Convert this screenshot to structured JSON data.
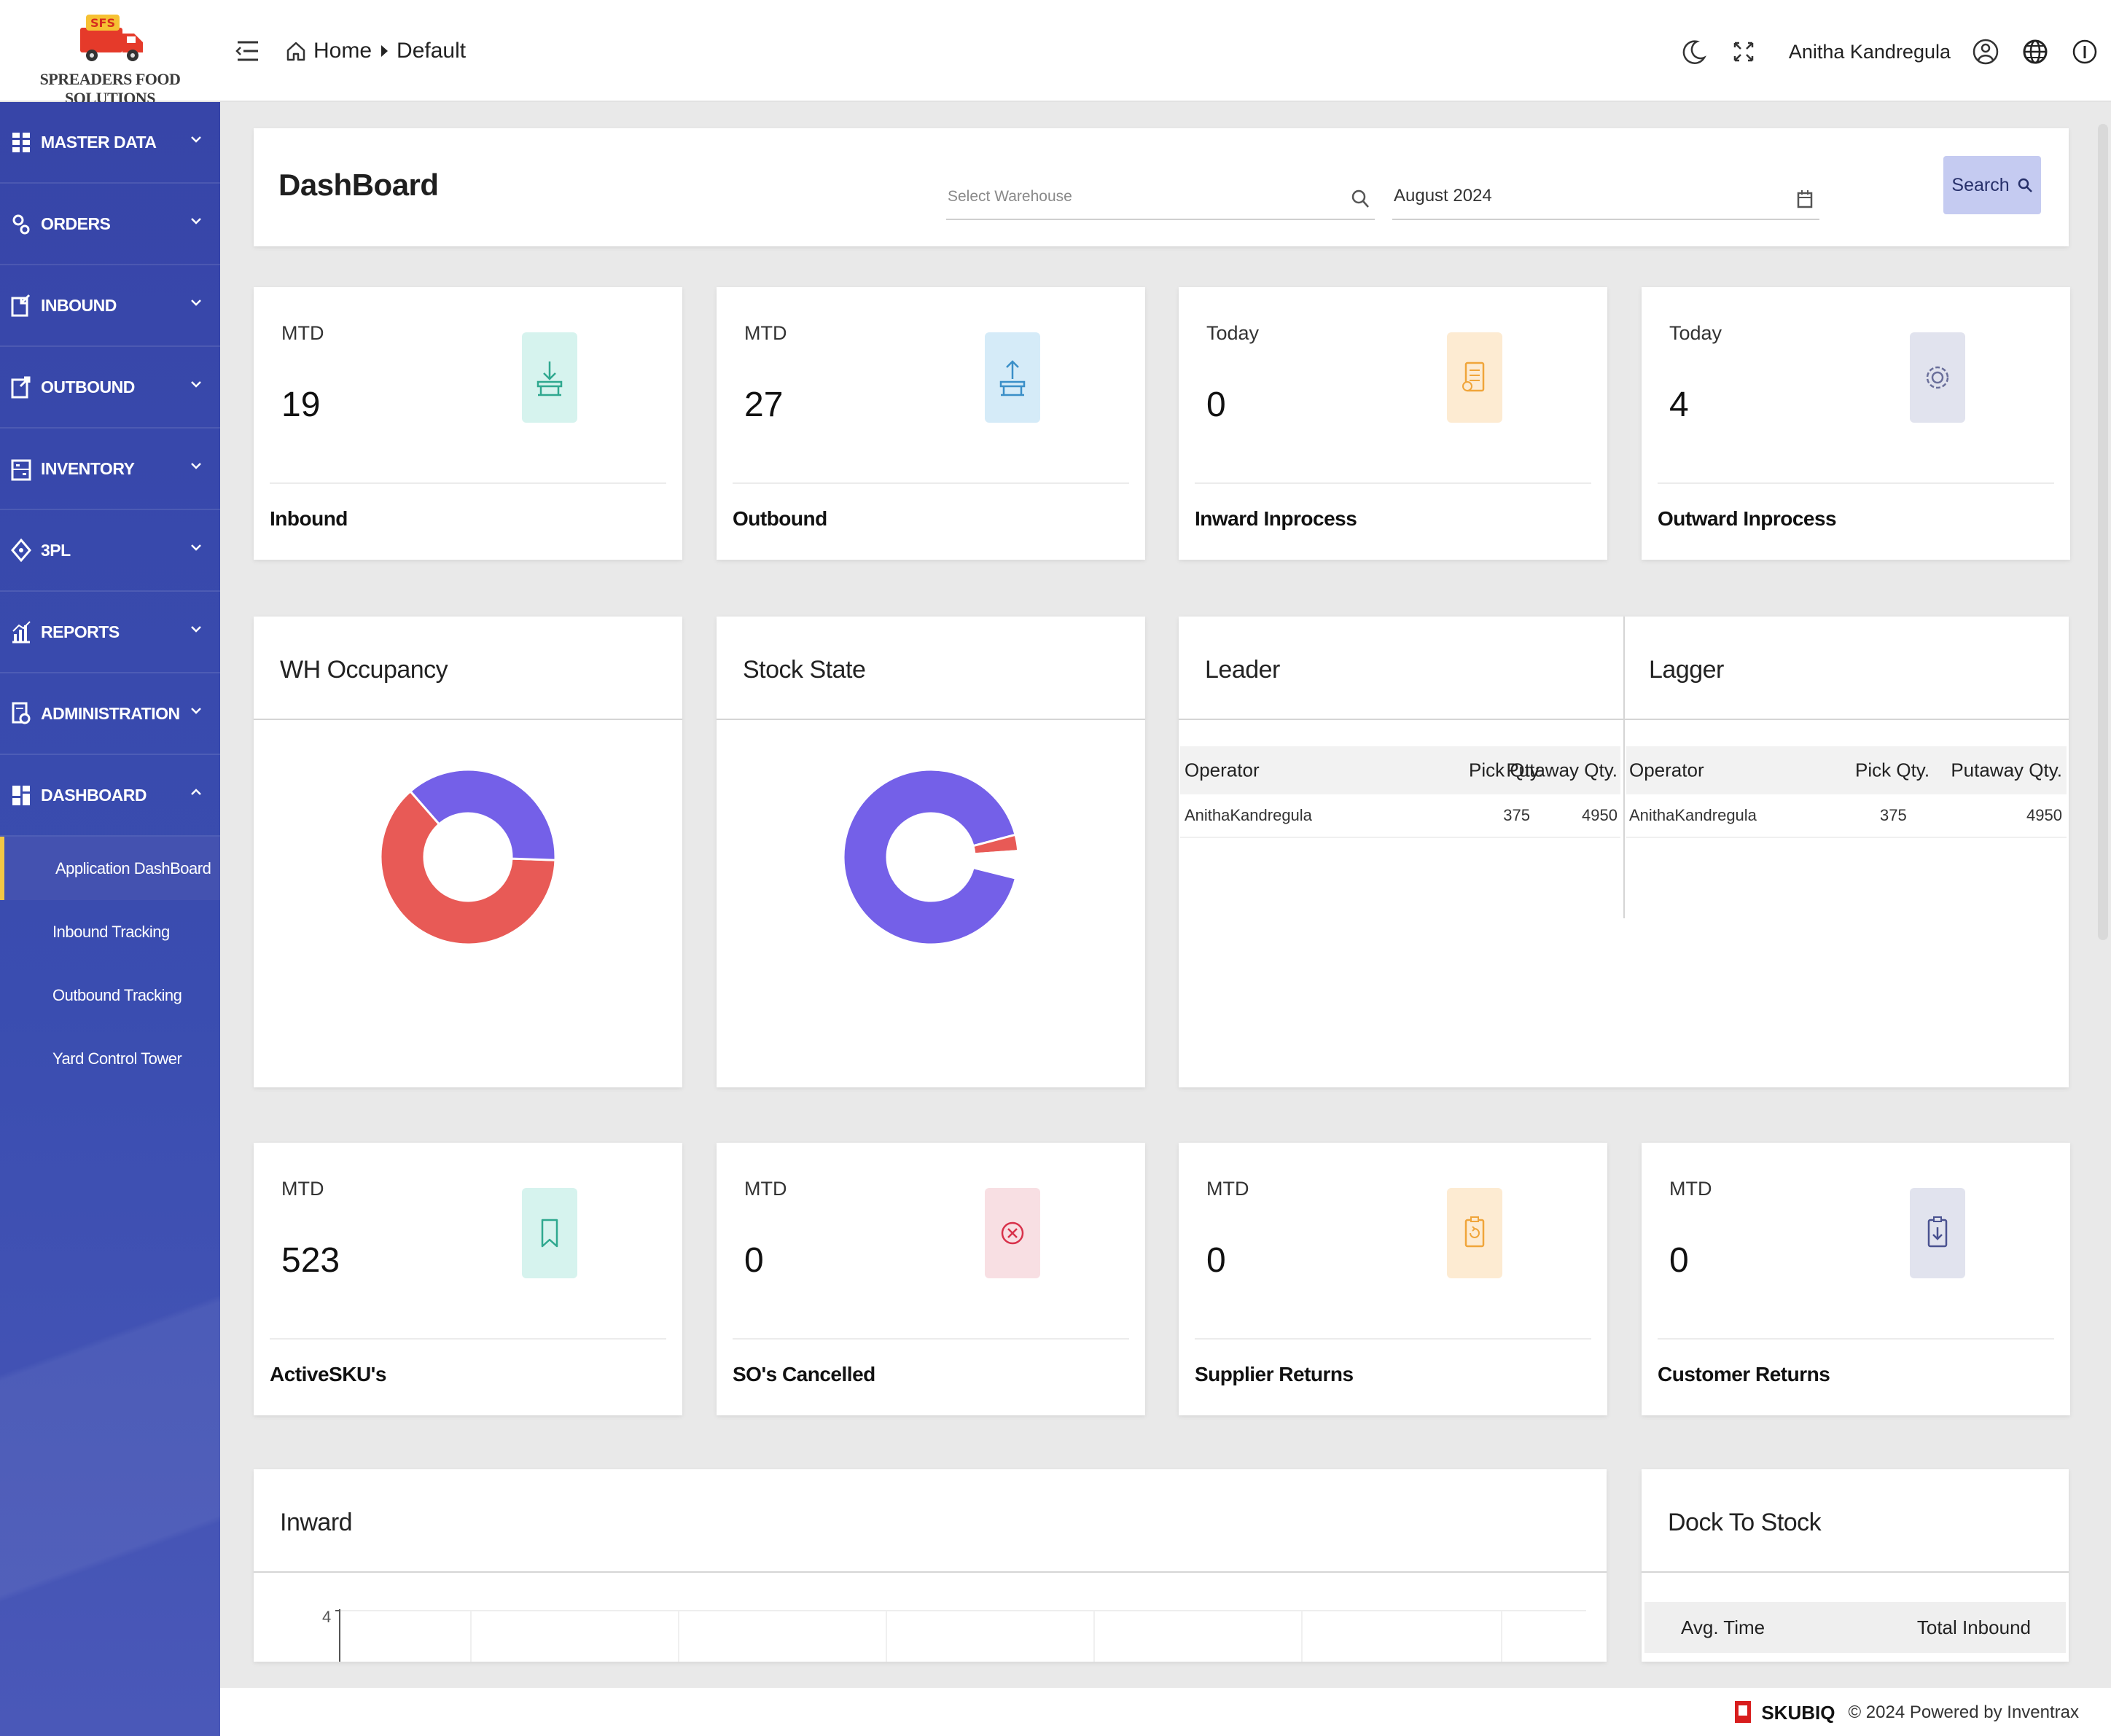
{
  "brand": {
    "logo_badge": "SFS",
    "name": "SPREADERS FOOD SOLUTIONS"
  },
  "topbar": {
    "breadcrumb": [
      "Home",
      "Default"
    ],
    "user_name": "Anitha  Kandregula",
    "icons": [
      "moon-icon",
      "fullscreen-icon",
      "user-circle-icon",
      "globe-icon",
      "info-icon"
    ]
  },
  "sidebar": {
    "items": [
      {
        "label": "MASTER DATA",
        "icon": "grid-icon"
      },
      {
        "label": "ORDERS",
        "icon": "gears-icon"
      },
      {
        "label": "INBOUND",
        "icon": "inbound-icon"
      },
      {
        "label": "OUTBOUND",
        "icon": "outbound-icon"
      },
      {
        "label": "INVENTORY",
        "icon": "inventory-icon"
      },
      {
        "label": "3PL",
        "icon": "diamond-icon"
      },
      {
        "label": "REPORTS",
        "icon": "bar-chart-icon"
      },
      {
        "label": "ADMINISTRATION",
        "icon": "admin-icon"
      },
      {
        "label": "DASHBOARD",
        "icon": "dashboard-icon",
        "expanded": true
      }
    ],
    "sub_items": [
      "Application DashBoard",
      "Inbound Tracking",
      "Outbound Tracking",
      "Yard Control Tower"
    ],
    "active_sub_item": "Application DashBoard"
  },
  "header": {
    "title": "DashBoard",
    "warehouse_placeholder": "Select Warehouse",
    "date_value": "August 2024",
    "search_label": "Search"
  },
  "stats_top": [
    {
      "period": "MTD",
      "value": "19",
      "label": "Inbound",
      "badge_color": "#d6f3ee",
      "icon": "truck-unload-icon"
    },
    {
      "period": "MTD",
      "value": "27",
      "label": "Outbound",
      "badge_color": "#d5ebf8",
      "icon": "truck-load-icon"
    },
    {
      "period": "Today",
      "value": "0",
      "label": "Inward Inprocess",
      "badge_color": "#fdebd2",
      "icon": "document-icon"
    },
    {
      "period": "Today",
      "value": "4",
      "label": "Outward Inprocess",
      "badge_color": "#e1e3ee",
      "icon": "gear-cycle-icon"
    }
  ],
  "charts": {
    "wh_occupancy": {
      "title": "WH Occupancy"
    },
    "stock_state": {
      "title": "Stock State"
    },
    "leader": {
      "title": "Leader",
      "columns": [
        "Operator",
        "Pick Qty.",
        "Putaway Qty."
      ],
      "rows": [
        [
          "AnithaKandregula",
          "375",
          "4950"
        ]
      ]
    },
    "lagger": {
      "title": "Lagger",
      "columns": [
        "Operator",
        "Pick Qty.",
        "Putaway Qty."
      ],
      "rows": [
        [
          "AnithaKandregula",
          "375",
          "4950"
        ]
      ]
    },
    "inward": {
      "title": "Inward",
      "y_tick": "4"
    },
    "dock_to_stock": {
      "title": "Dock To Stock",
      "columns": [
        "Avg. Time",
        "Total Inbound"
      ]
    }
  },
  "chart_data": [
    {
      "type": "pie",
      "chart": "WH Occupancy",
      "slices": [
        {
          "value": 0.63,
          "color": "#e85a56"
        },
        {
          "value": 0.37,
          "color": "#7460e8"
        }
      ]
    },
    {
      "type": "pie",
      "chart": "Stock State",
      "slices": [
        {
          "value": 0.92,
          "color": "#7460e8"
        },
        {
          "value": 0.03,
          "color": "#e85a56"
        },
        {
          "value": 0.05,
          "color": "#ffffff"
        }
      ]
    }
  ],
  "stats_bottom": [
    {
      "period": "MTD",
      "value": "523",
      "label": "ActiveSKU's",
      "badge_color": "#d6f3ee",
      "icon": "bookmark-icon"
    },
    {
      "period": "MTD",
      "value": "0",
      "label": "SO's Cancelled",
      "badge_color": "#f8dfe3",
      "icon": "cancel-icon"
    },
    {
      "period": "MTD",
      "value": "0",
      "label": "Supplier Returns",
      "badge_color": "#fdebd2",
      "icon": "clipboard-return-icon"
    },
    {
      "period": "MTD",
      "value": "0",
      "label": "Customer Returns",
      "badge_color": "#e1e3ee",
      "icon": "clipboard-download-icon"
    }
  ],
  "footer": {
    "brand": "SKUBIQ",
    "copyright": "© 2024 Powered by Inventrax"
  },
  "colors": {
    "sidebar": "#3a4db0",
    "accent_yellow": "#f2c744",
    "search_button": "#c5cbf1",
    "donut_red": "#e85a56",
    "donut_purple": "#7460e8"
  }
}
